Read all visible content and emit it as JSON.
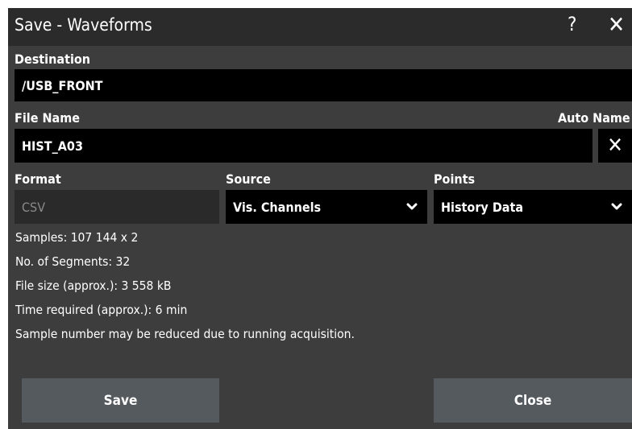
{
  "dialog": {
    "title": "Save - Waveforms",
    "help_symbol": "?",
    "close_symbol": "✕"
  },
  "destination": {
    "label": "Destination",
    "value": "/USB_FRONT"
  },
  "file_name": {
    "label": "File Name",
    "value": "HIST_A03",
    "auto_name_label": "Auto Name",
    "auto_name_symbol": "✕"
  },
  "format": {
    "label": "Format",
    "value": "CSV"
  },
  "source": {
    "label": "Source",
    "value": "Vis. Channels",
    "icon": "chevron-down-icon"
  },
  "points": {
    "label": "Points",
    "value": "History Data",
    "icon": "chevron-down-icon"
  },
  "info": {
    "samples": "Samples: 107 144 x 2",
    "segments": "No. of Segments: 32",
    "file_size": "File size (approx.): 3 558 kB",
    "time_required": "Time required (approx.): 6 min",
    "note": "Sample number may be reduced due to running acquisition."
  },
  "buttons": {
    "save": "Save",
    "close": "Close"
  },
  "colors": {
    "dialog_bg": "#3d3d3d",
    "titlebar_bg": "#2b2b2b",
    "field_bg": "#000000",
    "button_bg": "#555a5f"
  }
}
